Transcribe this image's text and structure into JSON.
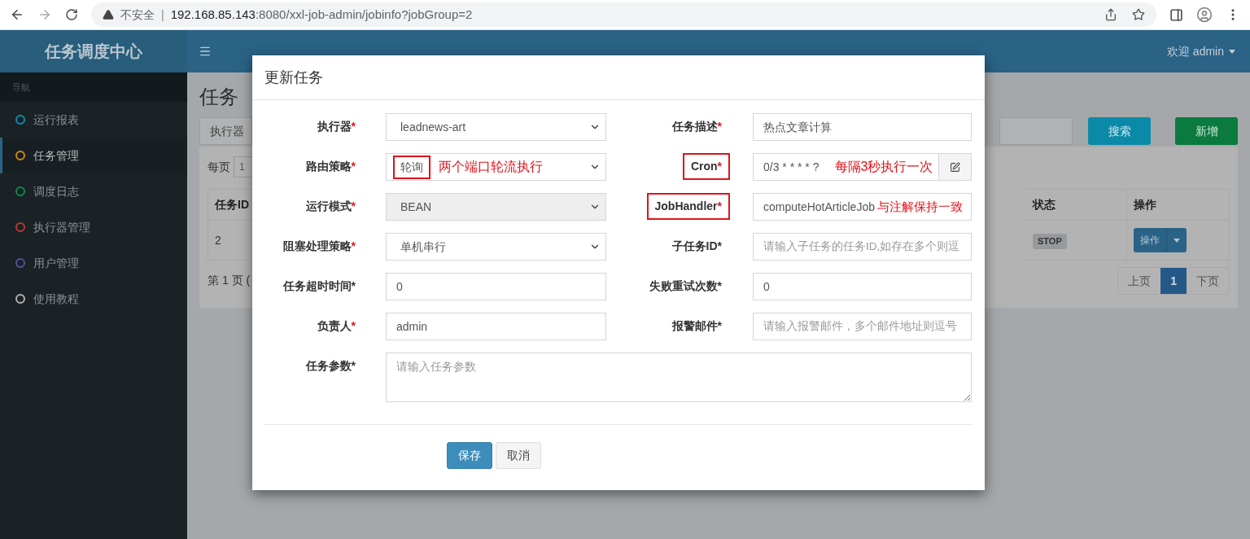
{
  "browser": {
    "security": "不安全",
    "separator": "|",
    "url_host": "192.168.85.143",
    "url_rest": ":8080/xxl-job-admin/jobinfo?jobGroup=2"
  },
  "header": {
    "brand": "任务调度中心",
    "user": "欢迎 admin"
  },
  "sidebar": {
    "heading": "导航",
    "items": [
      {
        "label": "运行报表",
        "color": "#0b8fb0",
        "selected": false
      },
      {
        "label": "任务管理",
        "color": "#c98a14",
        "selected": true
      },
      {
        "label": "调度日志",
        "color": "#0a8a4a",
        "selected": false
      },
      {
        "label": "执行器管理",
        "color": "#b83a2e",
        "selected": false
      },
      {
        "label": "用户管理",
        "color": "#56519a",
        "selected": false
      },
      {
        "label": "使用教程",
        "color": "#b0b0b0",
        "selected": false
      }
    ]
  },
  "page": {
    "title": "任务",
    "filter_label": "执行器",
    "buttons": [
      {
        "label": "搜索",
        "kind": "info"
      },
      {
        "label": "新增",
        "kind": "success"
      }
    ],
    "per_page_label": "每页",
    "per_page_value": "1",
    "table": {
      "columns": [
        "任务ID",
        "状态",
        "操作"
      ],
      "rows": [
        {
          "id": "2",
          "status": "STOP",
          "action": "操作"
        }
      ]
    },
    "page_info": "第 1 页 (",
    "pagination": [
      {
        "label": "上页",
        "selected": false
      },
      {
        "label": "1",
        "selected": true
      },
      {
        "label": "下页",
        "selected": false
      }
    ]
  },
  "modal": {
    "title": "更新任务",
    "fields": [
      {
        "label": "执行器",
        "star": "*",
        "star_red": true,
        "label_boxed": false,
        "kind": "select",
        "value": "leadnews-art"
      },
      {
        "label": "任务描述",
        "star": "*",
        "star_red": true,
        "label_boxed": false,
        "kind": "input",
        "value": "热点文章计算"
      },
      {
        "label": "路由策略",
        "star": "*",
        "star_red": true,
        "label_boxed": false,
        "kind": "select",
        "value": "轮询",
        "value_boxed": true,
        "note": "两个端口轮流执行"
      },
      {
        "label": "Cron",
        "star": "*",
        "star_red": true,
        "label_boxed": true,
        "kind": "input_addon",
        "value": "0/3 * * * * ?",
        "note": "每隔3秒执行一次"
      },
      {
        "label": "运行模式",
        "star": "*",
        "star_red": true,
        "label_boxed": false,
        "kind": "select",
        "value": "BEAN",
        "disabled": true
      },
      {
        "label": "JobHandler",
        "star": "*",
        "star_red": true,
        "label_boxed": true,
        "kind": "input",
        "value": "computeHotArticleJob",
        "note": "与注解保持一致"
      },
      {
        "label": "阻塞处理策略",
        "star": "*",
        "star_red": true,
        "label_boxed": false,
        "kind": "select",
        "value": "单机串行"
      },
      {
        "label": "子任务ID",
        "star": "*",
        "star_red": false,
        "label_boxed": false,
        "kind": "input",
        "placeholder": "请输入子任务的任务ID,如存在多个则逗"
      },
      {
        "label": "任务超时时间",
        "star": "*",
        "star_red": false,
        "label_boxed": false,
        "kind": "input",
        "value": "0"
      },
      {
        "label": "失败重试次数",
        "star": "*",
        "star_red": false,
        "label_boxed": false,
        "kind": "input",
        "value": "0"
      },
      {
        "label": "负责人",
        "star": "*",
        "star_red": true,
        "label_boxed": false,
        "kind": "input",
        "value": "admin"
      },
      {
        "label": "报警邮件",
        "star": "*",
        "star_red": false,
        "label_boxed": false,
        "kind": "input",
        "placeholder": "请输入报警邮件，多个邮件地址则逗号"
      },
      {
        "label": "任务参数",
        "star": "*",
        "star_red": false,
        "label_boxed": false,
        "kind": "textarea",
        "placeholder": "请输入任务参数"
      }
    ],
    "buttons": [
      {
        "label": "保存",
        "kind": "primary"
      },
      {
        "label": "取消",
        "kind": "default"
      }
    ]
  }
}
